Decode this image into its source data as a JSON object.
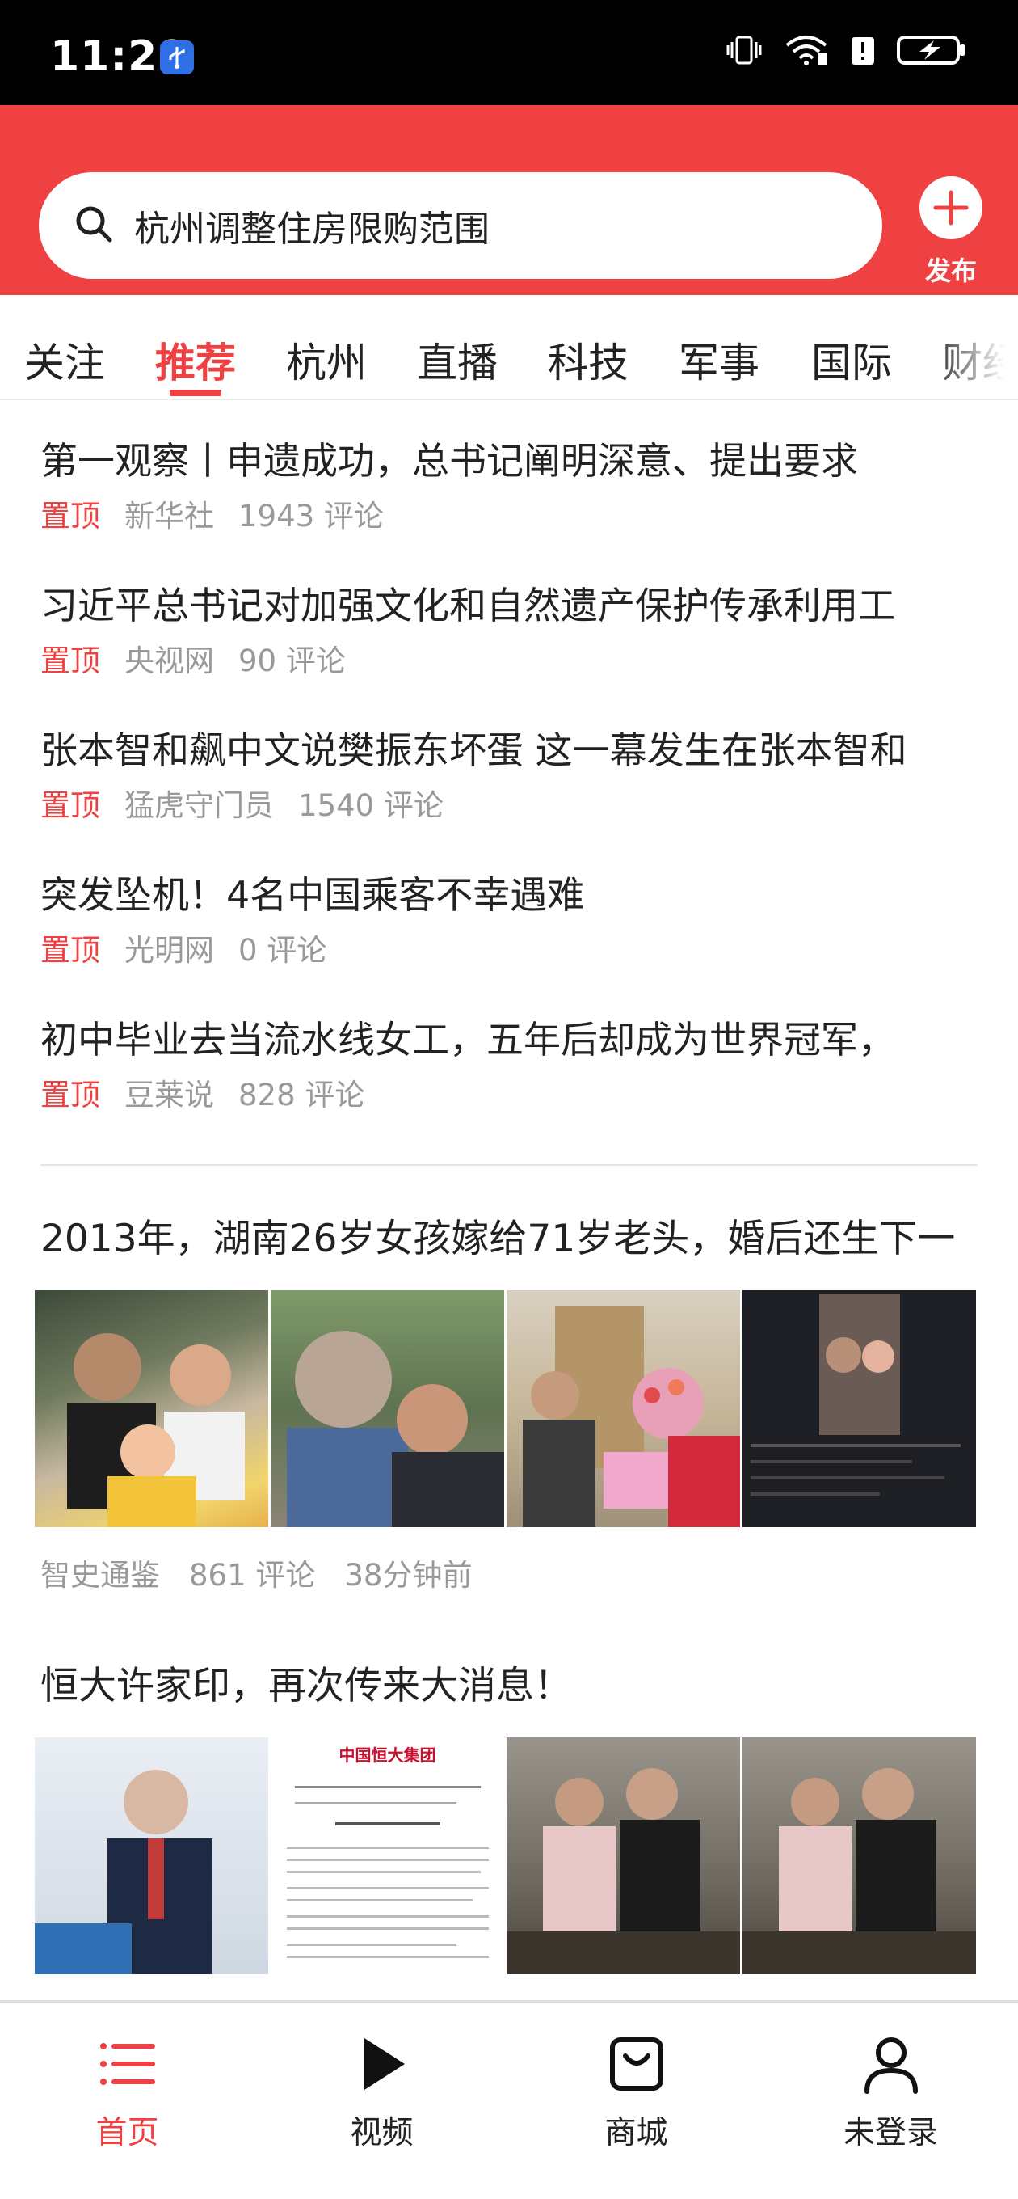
{
  "status_bar": {
    "time": "11:29"
  },
  "search": {
    "query": "杭州调整住房限购范围",
    "publish_label": "发布"
  },
  "tabs": [
    {
      "label": "关注",
      "active": false
    },
    {
      "label": "推荐",
      "active": true
    },
    {
      "label": "杭州",
      "active": false
    },
    {
      "label": "直播",
      "active": false
    },
    {
      "label": "科技",
      "active": false
    },
    {
      "label": "军事",
      "active": false
    },
    {
      "label": "国际",
      "active": false
    },
    {
      "label": "财经",
      "active": false
    }
  ],
  "pinned_news": [
    {
      "title": "第一观察丨申遗成功，总书记阐明深意、提出要求",
      "tag": "置顶",
      "source": "新华社",
      "comments": "1943 评论"
    },
    {
      "title": "习近平总书记对加强文化和自然遗产保护传承利用工",
      "tag": "置顶",
      "source": "央视网",
      "comments": "90 评论"
    },
    {
      "title": "张本智和飙中文说樊振东坏蛋 这一幕发生在张本智和",
      "tag": "置顶",
      "source": "猛虎守门员",
      "comments": "1540 评论"
    },
    {
      "title": "突发坠机！4名中国乘客不幸遇难",
      "tag": "置顶",
      "source": "光明网",
      "comments": "0 评论"
    },
    {
      "title": "初中毕业去当流水线女工，五年后却成为世界冠军，",
      "tag": "置顶",
      "source": "豆莱说",
      "comments": "828 评论"
    }
  ],
  "articles": [
    {
      "title": "2013年，湖南26岁女孩嫁给71岁老头，婚后还生下一",
      "source": "智史通鉴",
      "comments": "861 评论",
      "time": "38分钟前"
    },
    {
      "title": "恒大许家印，再次传来大消息！",
      "doc_header": "中国恒大集团"
    }
  ],
  "bottom_nav": [
    {
      "label": "首页",
      "icon": "list-icon",
      "active": true
    },
    {
      "label": "视频",
      "icon": "play-icon",
      "active": false
    },
    {
      "label": "商城",
      "icon": "shopping-bag-icon",
      "active": false
    },
    {
      "label": "未登录",
      "icon": "user-icon",
      "active": false
    }
  ],
  "colors": {
    "accent": "#f04142",
    "meta_text": "#999999"
  }
}
